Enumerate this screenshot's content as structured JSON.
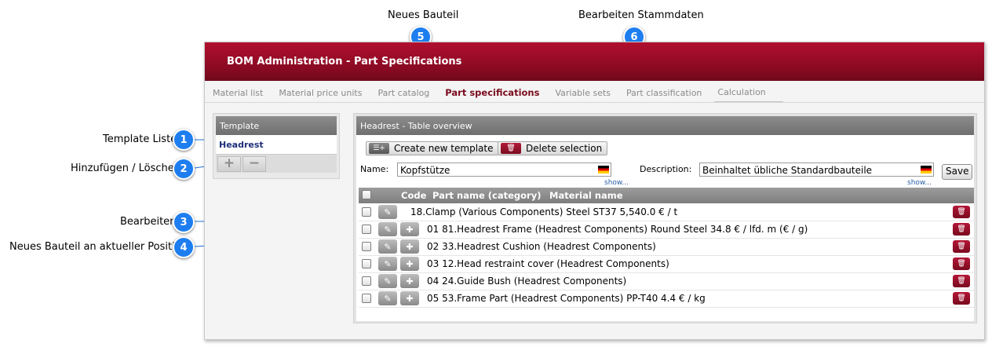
{
  "annotations": {
    "new_part": {
      "number": "5",
      "label": "Neues Bauteil"
    },
    "edit_master": {
      "number": "6",
      "label": "Bearbeiten Stammdaten"
    },
    "template_list": {
      "number": "1",
      "label": "Template Liste"
    },
    "add_remove": {
      "number": "2",
      "label": "Hinzufügen / Löschen"
    },
    "edit": {
      "number": "3",
      "label": "Bearbeiten"
    },
    "new_part_at_position": {
      "number": "4",
      "label": "Neues Bauteil an aktueller Position"
    }
  },
  "app": {
    "title": "BOM Administration - Part Specifications",
    "nav": [
      "Material list",
      "Material price units",
      "Part catalog",
      "Part specifications",
      "Variable sets",
      "Part classification",
      "Calculation"
    ],
    "active_tab": "Part specifications"
  },
  "template_panel": {
    "title": "Template",
    "items": [
      "Headrest"
    ],
    "add_symbol": "+",
    "remove_symbol": "−"
  },
  "table_panel": {
    "title": "Headrest - Table overview",
    "create_button": "Create new template",
    "delete_button": "Delete selection",
    "name_label": "Name:",
    "name_value": "Kopfstütze",
    "description_label": "Description:",
    "description_value": "Beinhaltet übliche Standardbauteile",
    "show_link": "show...",
    "save_button": "Save",
    "columns": [
      "Code",
      "Part name (category)",
      "Material name"
    ],
    "rows": [
      {
        "text": "18.Clamp (Various Components)  Steel ST37 5,540.0 € / t",
        "has_insert": false
      },
      {
        "text": "01  81.Headrest Frame (Headrest Components)  Round Steel 34.8 € / lfd. m (€ / g)",
        "has_insert": true
      },
      {
        "text": "02  33.Headrest Cushion (Headrest Components)",
        "has_insert": true
      },
      {
        "text": "03  12.Head restraint cover (Headrest Components)",
        "has_insert": true
      },
      {
        "text": "04  24.Guide Bush (Headrest Components)",
        "has_insert": true
      },
      {
        "text": "05  53.Frame Part (Headrest Components)  PP-T40 4.4 € / kg",
        "has_insert": true
      }
    ]
  },
  "colors": {
    "brand": "#9a0d27",
    "callout": "#1e7ef0",
    "link": "#2a5fa8"
  }
}
